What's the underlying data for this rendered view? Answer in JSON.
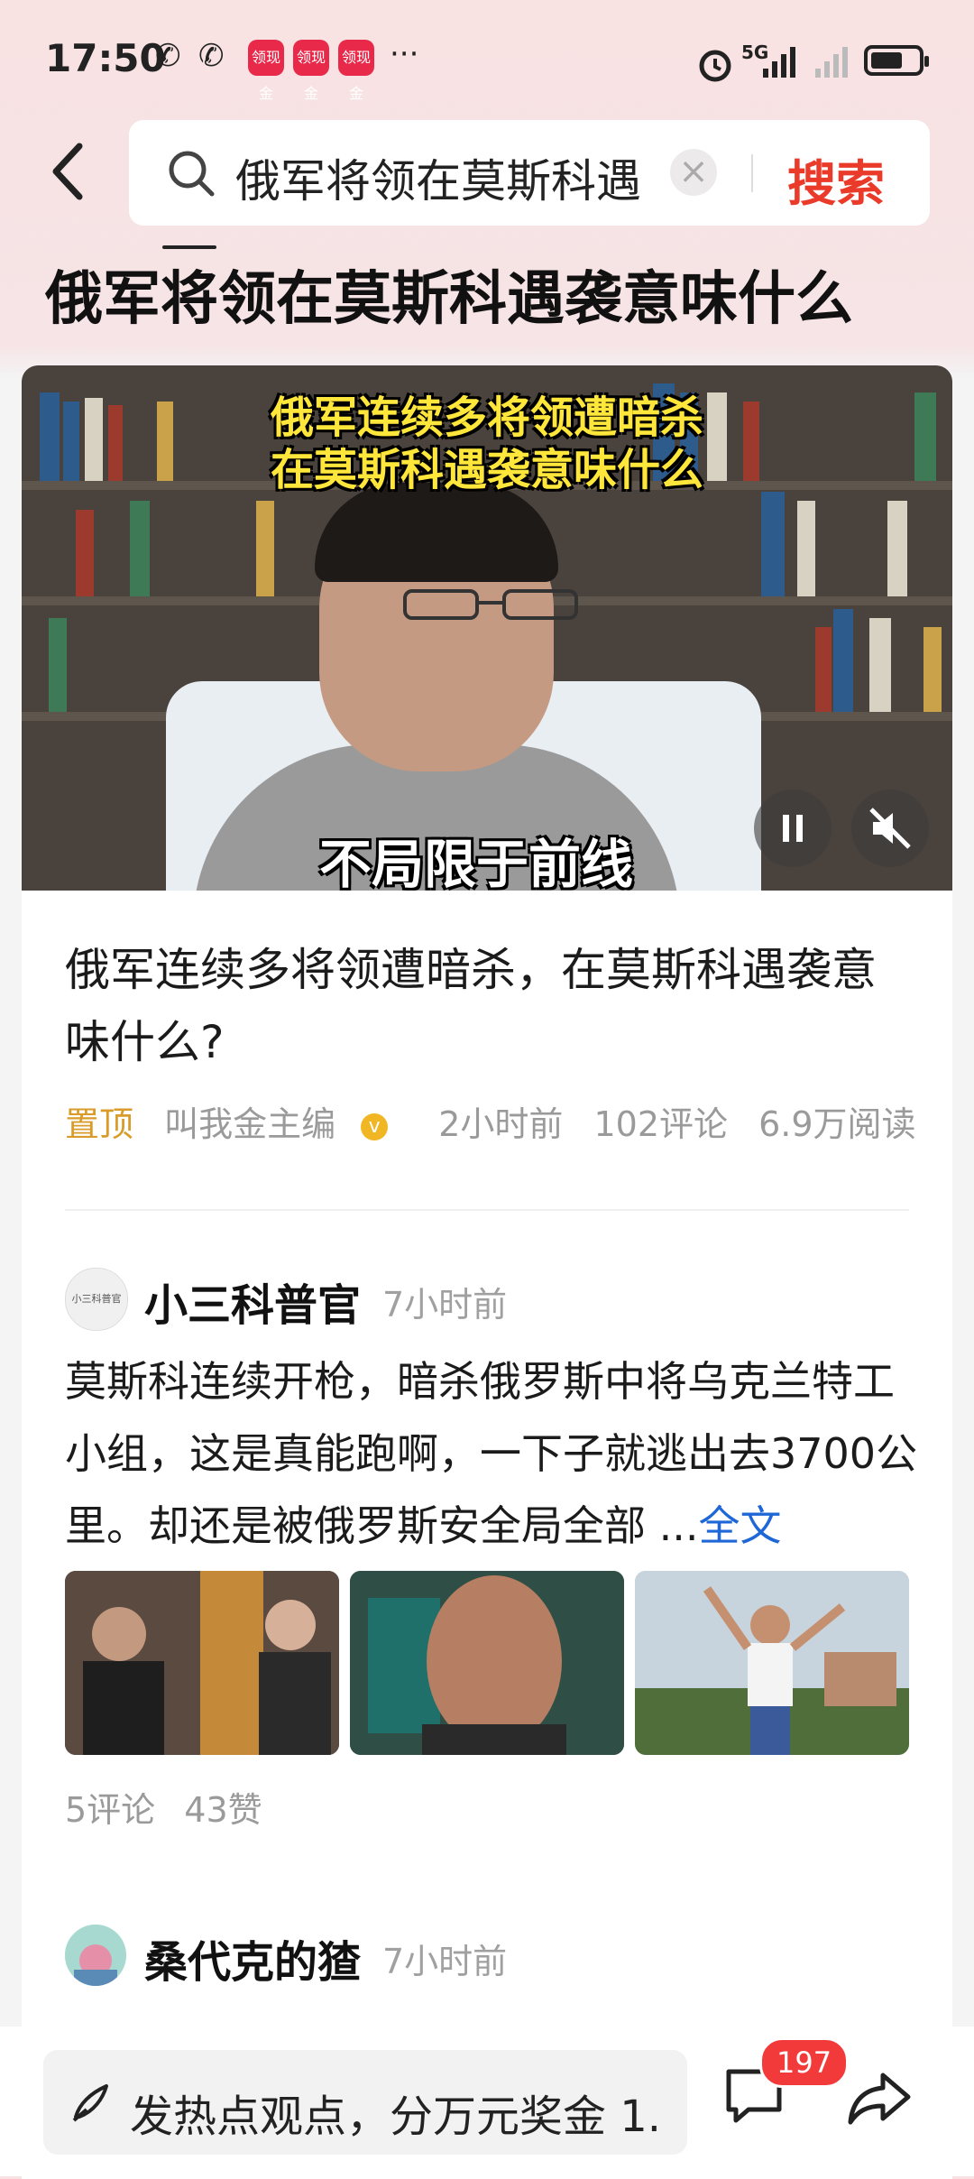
{
  "status_bar": {
    "time": "17:50",
    "network": "5G",
    "app_badge_text": "领现金",
    "overflow": "···"
  },
  "search": {
    "query": "俄军将领在莫斯科遇",
    "submit_label": "搜索"
  },
  "page": {
    "title": "俄军将领在莫斯科遇袭意味什么"
  },
  "video_card": {
    "overlay_line1": "俄军连续多将领遭暗杀",
    "overlay_line2": "在莫斯科遇袭意味什么",
    "subtitle": "不局限于前线",
    "title": "俄军连续多将领遭暗杀，在莫斯科遇袭意味什么?",
    "pin_label": "置顶",
    "author": "叫我金主编",
    "time_ago": "2小时前",
    "comments": "102评论",
    "reads": "6.9万阅读"
  },
  "posts": [
    {
      "avatar_text": "小三科普官",
      "author": "小三科普官",
      "time_ago": "7小时前",
      "text": "莫斯科连续开枪，暗杀俄罗斯中将乌克兰特工小组，这是真能跑啊，一下子就逃出去3700公里。却还是被俄罗斯安全局全部 ...",
      "more_label": "全文",
      "comments": "5评论",
      "likes": "43赞"
    },
    {
      "author": "桑代克的猹",
      "time_ago": "7小时前"
    }
  ],
  "bottom_bar": {
    "comment_placeholder": "发热点观点，分万元奖金 1...",
    "comment_count": "197"
  },
  "colors": {
    "accent_red": "#ea3a2a",
    "pin_orange": "#d99b2a",
    "link_blue": "#1f67d6"
  }
}
